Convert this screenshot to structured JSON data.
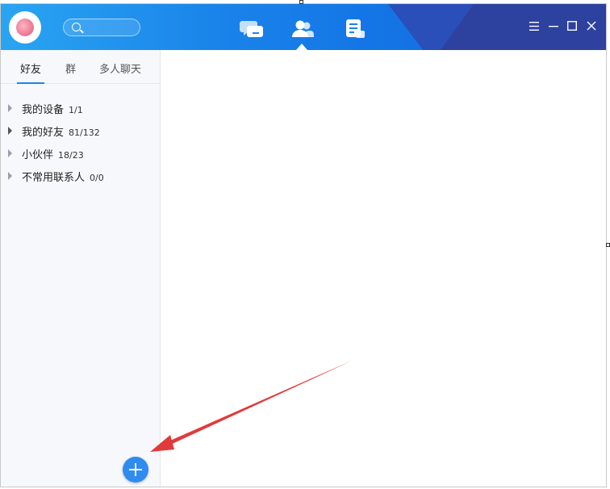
{
  "sidebar": {
    "tabs": [
      {
        "label": "好友"
      },
      {
        "label": "群"
      },
      {
        "label": "多人聊天"
      }
    ],
    "groups": [
      {
        "name": "我的设备",
        "count": "1/1"
      },
      {
        "name": "我的好友",
        "count": "81/132"
      },
      {
        "name": "小伙伴",
        "count": "18/23"
      },
      {
        "name": "不常用联系人",
        "count": "0/0"
      }
    ]
  },
  "header": {
    "nav": [
      "chat-bubbles-icon",
      "contacts-icon",
      "notes-icon"
    ],
    "window_controls": [
      "menu-icon",
      "minimize-icon",
      "maximize-icon",
      "close-icon"
    ]
  },
  "colors": {
    "titlebar": "#1a84ea",
    "accent": "#2f8bf0",
    "arrow": "#e23a3a"
  }
}
